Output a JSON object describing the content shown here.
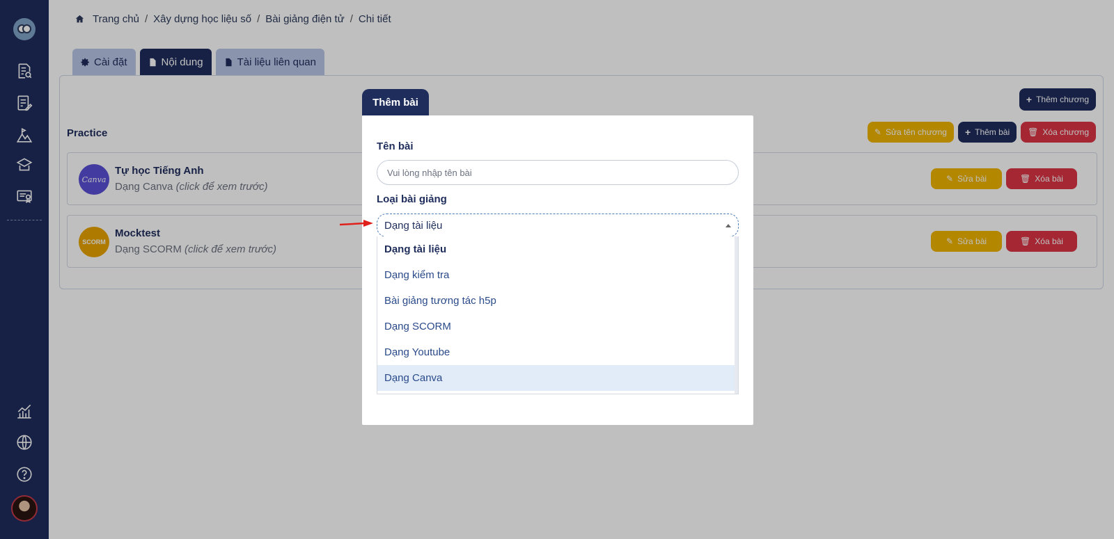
{
  "breadcrumb": {
    "home": "Trang chủ",
    "level2": "Xây dựng học liệu số",
    "level3": "Bài giảng điện tử",
    "current": "Chi tiết",
    "separator": "/"
  },
  "tabs": {
    "settings": "Cài đặt",
    "content": "Nội dung",
    "related_docs": "Tài liệu liên quan"
  },
  "content": {
    "add_chapter": "Thêm chương",
    "chapter_title": "Practice",
    "edit_chapter_name": "Sửa tên chương",
    "add_lesson": "Thêm bài",
    "delete_chapter": "Xóa chương",
    "lessons": [
      {
        "name": "Tự học Tiếng Anh",
        "type": "Dạng Canva",
        "hint": "(click để xem trước)",
        "thumb": "Canva",
        "thumb_color": "#5b4fd6",
        "edit": "Sửa bài",
        "delete": "Xóa bài"
      },
      {
        "name": "Mocktest",
        "type": "Dạng SCORM",
        "hint": "(click để xem trước)",
        "thumb": "SCORM",
        "thumb_color": "#e8a500",
        "edit": "Sửa bài",
        "delete": "Xóa bài"
      }
    ]
  },
  "modal": {
    "tab_title": "Thêm bài",
    "lesson_name_label": "Tên bài",
    "lesson_name_placeholder": "Vui lòng nhập tên bài",
    "lesson_type_label": "Loại bài giảng",
    "selected_type": "Dạng tài liệu",
    "options": [
      "Dạng tài liệu",
      "Dạng kiểm tra",
      "Bài giảng tương tác h5p",
      "Dạng SCORM",
      "Dạng Youtube",
      "Dạng Canva"
    ]
  },
  "colors": {
    "navy": "#1f2d5c",
    "yellow": "#f0b400",
    "red": "#dc3545",
    "tab_inactive": "#b9c6e6"
  }
}
